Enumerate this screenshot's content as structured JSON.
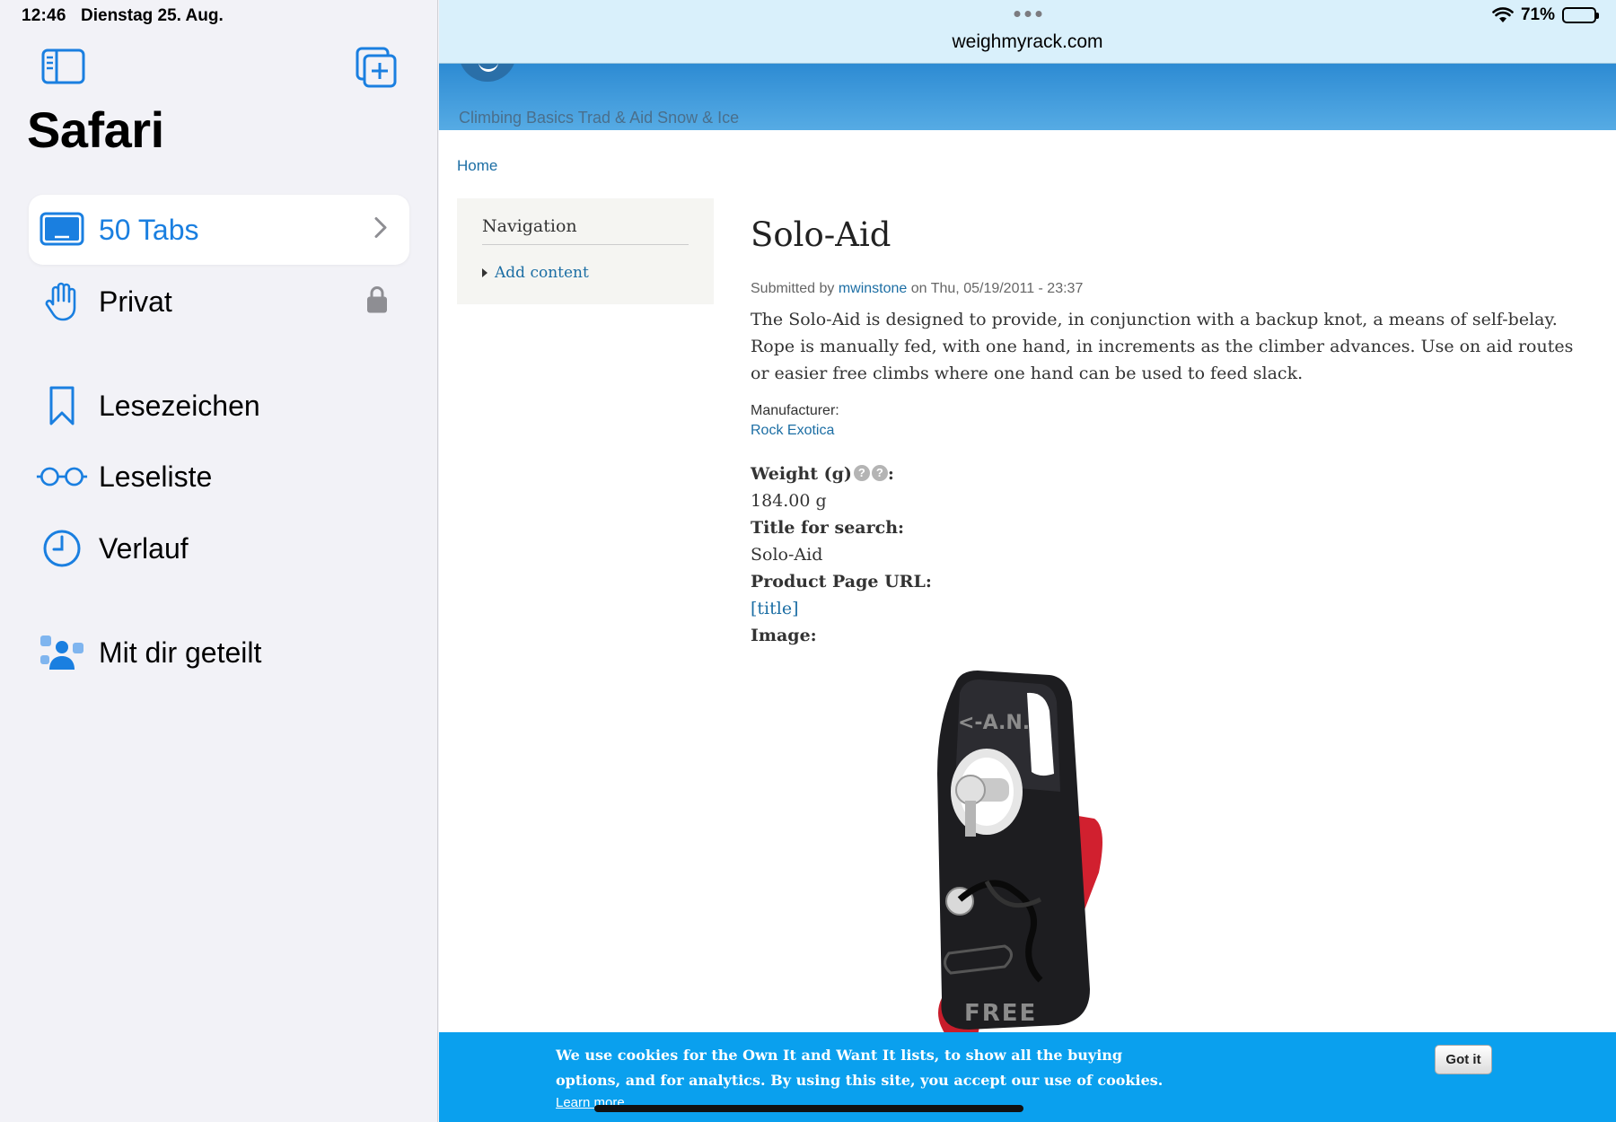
{
  "status": {
    "time": "12:46",
    "date": "Dienstag 25. Aug.",
    "battery_text": "71%",
    "battery_level": 0.71
  },
  "sidebar": {
    "title": "Safari",
    "items": [
      {
        "label": "50 Tabs",
        "icon": "tabs-icon",
        "selected": true
      },
      {
        "label": "Privat",
        "icon": "hand-icon"
      },
      {
        "label": "Lesezeichen",
        "icon": "bookmark-icon"
      },
      {
        "label": "Leseliste",
        "icon": "glasses-icon"
      },
      {
        "label": "Verlauf",
        "icon": "clock-icon"
      },
      {
        "label": "Mit dir geteilt",
        "icon": "shared-people-icon"
      }
    ]
  },
  "browser": {
    "url": "weighmyrack.com"
  },
  "site": {
    "nav_text": "Climbing Basics Trad & Aid Snow & Ice",
    "breadcrumb": "Home",
    "navigation_title": "Navigation",
    "navigation_link": "Add content"
  },
  "node": {
    "title": "Solo-Aid",
    "submitted_prefix": "Submitted by",
    "author": "mwinstone",
    "submitted_suffix": "on Thu, 05/19/2011 - 23:37",
    "body": "The Solo-Aid is designed to provide, in conjunction with a backup knot, a means of self-belay. Rope is manually fed, with one hand, in increments as the climber advances. Use on aid routes or easier free climbs where one hand can be used to feed slack.",
    "manufacturer_label": "Manufacturer:",
    "manufacturer": "Rock Exotica",
    "weight_label": "Weight (g)",
    "weight_help_1": "?",
    "weight_help_2": "?",
    "weight_colon": ":",
    "weight_value": "184.00 g",
    "search_title_label": "Title for search:",
    "search_title_value": "Solo-Aid",
    "product_url_label": "Product Page URL:",
    "product_url_value": "[title]",
    "image_label": "Image:",
    "product_engraving_top": "<-A.N.",
    "product_engraving_bottom": "FREE"
  },
  "cookie": {
    "text": "We use cookies for the Own It and Want It lists, to show all the buying options, and for analytics. By using this site, you accept our use of cookies.",
    "learn_more": "Learn more",
    "button": "Got it"
  }
}
